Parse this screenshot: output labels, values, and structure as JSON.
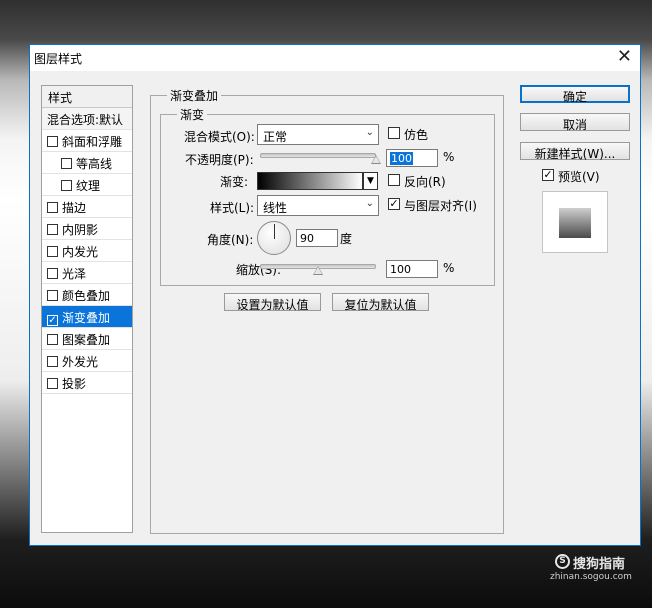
{
  "dialog": {
    "title": "图层样式",
    "close_glyph": "✕"
  },
  "styles_panel": {
    "header": "样式",
    "blend_options": "混合选项:默认",
    "items": [
      {
        "label": "斜面和浮雕",
        "checked": false
      },
      {
        "label": "等高线",
        "checked": false
      },
      {
        "label": "纹理",
        "checked": false
      },
      {
        "label": "描边",
        "checked": false
      },
      {
        "label": "内阴影",
        "checked": false
      },
      {
        "label": "内发光",
        "checked": false
      },
      {
        "label": "光泽",
        "checked": false
      },
      {
        "label": "颜色叠加",
        "checked": false
      },
      {
        "label": "渐变叠加",
        "checked": true,
        "selected": true
      },
      {
        "label": "图案叠加",
        "checked": false
      },
      {
        "label": "外发光",
        "checked": false
      },
      {
        "label": "投影",
        "checked": false
      }
    ]
  },
  "gradient_overlay": {
    "group_title": "渐变叠加",
    "sub_group_title": "渐变",
    "blend_mode_label": "混合模式(O):",
    "blend_mode_value": "正常",
    "dither_label": "仿色",
    "dither_checked": false,
    "opacity_label": "不透明度(P):",
    "opacity_value": "100",
    "opacity_unit": "%",
    "opacity_fraction": 1.0,
    "gradient_label": "渐变:",
    "reverse_label": "反向(R)",
    "reverse_checked": false,
    "style_label": "样式(L):",
    "style_value": "线性",
    "align_label": "与图层对齐(I)",
    "align_checked": true,
    "angle_label": "角度(N):",
    "angle_value": "90",
    "angle_unit": "度",
    "scale_label": "缩放(S):",
    "scale_value": "100",
    "scale_unit": "%",
    "scale_fraction": 0.5,
    "set_default_button": "设置为默认值",
    "reset_default_button": "复位为默认值"
  },
  "right_buttons": {
    "ok": "确定",
    "cancel": "取消",
    "new_style": "新建样式(W)...",
    "preview_label": "预览(V)",
    "preview_checked": true
  },
  "watermark": {
    "icon_glyph": "S",
    "text": "搜狗指南",
    "url": "zhinan.sogou.com"
  },
  "glyphs": {
    "check": "✓",
    "dropdown": "⌄",
    "triangle_down": "▼"
  },
  "colors": {
    "selection_blue": "#0a74da",
    "border_blue": "#0a71c9"
  }
}
